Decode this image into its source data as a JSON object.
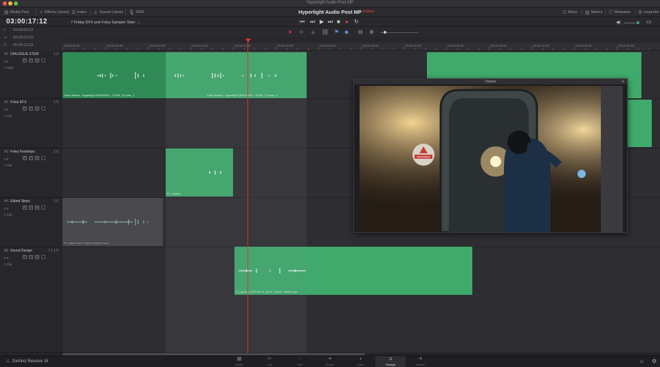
{
  "window": {
    "title": "Hyperlight Audio Post MP"
  },
  "toolbar": {
    "media_pool": "Media Pool",
    "effects_library": "Effects Library",
    "index": "Index",
    "sound_library": "Sound Library",
    "adr": "ADR",
    "project_title": "Hyperlight Audio Post MP",
    "project_status": "Edited",
    "mixer": "Mixer",
    "meters": "Meters",
    "metadata": "Metadata",
    "inspector": "Inspector"
  },
  "timeline": {
    "timecode": "03:00:17:12",
    "name": "7 Friday DFX and Foley Sampler Start",
    "tc_rows": [
      {
        "key": "≡",
        "val": "03:00:09:14"
      },
      {
        "key": "⇥",
        "val": "03:00:23:22"
      },
      {
        "key": "⏱",
        "val": "00:00:13:23"
      }
    ],
    "ruler_labels": [
      "03:00:00:00",
      "03:00:04:00",
      "03:00:08:00",
      "03:00:12:00",
      "03:00:16:00",
      "03:00:20:00",
      "03:00:24:00",
      "03:00:28:00",
      "03:00:32:00",
      "03:00:36:00",
      "03:00:40:00",
      "03:00:44:00",
      "03:00:48:00",
      "03:00:52:00"
    ]
  },
  "tracks": [
    {
      "id": "A1",
      "name": "DIALOGUE STEM",
      "ch": "1.0",
      "vol": "0.0",
      "clips": "3 Clips"
    },
    {
      "id": "A2",
      "name": "Foley EFX",
      "ch": "1.0",
      "vol": "0.0",
      "clips": "1 Clip"
    },
    {
      "id": "A3",
      "name": "Foley Footsteps",
      "ch": "1.0",
      "vol": "0.0",
      "clips": "1 Clip"
    },
    {
      "id": "A4",
      "name": "Edited Steps",
      "ch": "1.0",
      "vol": "0.0",
      "clips": "1 Clip"
    },
    {
      "id": "A5",
      "name": "Sound Design",
      "ch": "7.1 1.0",
      "vol": "0.0",
      "clips": "1 Clip"
    }
  ],
  "clips": {
    "a1_left": "Cairo Station - Hyperlight DENOISED - STEM_CO.wav_1",
    "a1_mid": "Cairo Station - Hyperlight DENOISED - STEM_CO.wav_1",
    "a3": "F1_replace",
    "a4": "F1_steps take 1 mixed (foley).flt.wav",
    "a5": "F1_spray-n_DFX-M-F2_ALOL_FADE_FINISH.wav"
  },
  "viewer": {
    "title": "Viewer",
    "sign_text": "WARNING"
  },
  "pages": [
    {
      "label": "Media",
      "icon": "▦"
    },
    {
      "label": "Cut",
      "icon": "✂"
    },
    {
      "label": "Edit",
      "icon": "⫶"
    },
    {
      "label": "Fusion",
      "icon": "✦"
    },
    {
      "label": "Color",
      "icon": "◑"
    },
    {
      "label": "Fairlight",
      "icon": "♫"
    },
    {
      "label": "Deliver",
      "icon": "✈"
    }
  ],
  "brand": "DaVinci Resolve 16",
  "colors": {
    "clip": "#3faa6b",
    "clip_dark": "#2f8a55",
    "clip_gray": "#4a4a4e",
    "playhead": "#d23a2f",
    "accent": "#e0463a"
  }
}
